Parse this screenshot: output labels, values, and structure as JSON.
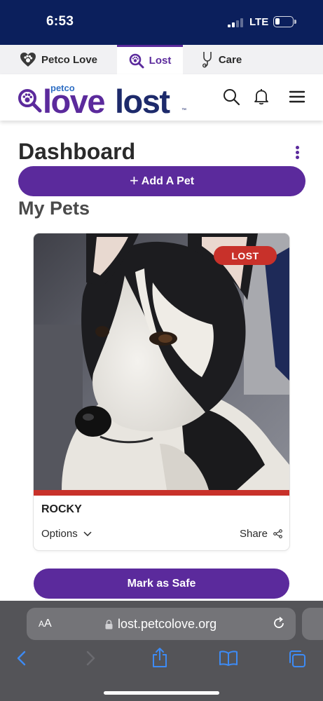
{
  "status_bar": {
    "time": "6:53",
    "carrier": "LTE",
    "battery_level": 0.28
  },
  "brand_tabs": [
    {
      "label": "Petco Love",
      "icon": "heart-paw-icon",
      "active": false
    },
    {
      "label": "Lost",
      "icon": "search-paw-icon",
      "active": true
    },
    {
      "label": "Care",
      "icon": "stethoscope-icon",
      "active": false
    }
  ],
  "header": {
    "logo_petco": "petco",
    "logo_love": "love",
    "logo_lost": "lost",
    "logo_tm": "™",
    "icons": [
      "search-icon",
      "bell-icon",
      "hamburger-menu-icon"
    ]
  },
  "dashboard": {
    "title": "Dashboard",
    "add_pet_plus": "+",
    "add_pet_label": "Add A Pet",
    "my_pets_heading": "My Pets"
  },
  "pet_card": {
    "status_badge": "LOST",
    "name": "ROCKY",
    "options_label": "Options",
    "share_label": "Share",
    "photo": "husky-dog-photo"
  },
  "mark_safe_label": "Mark as Safe",
  "browser": {
    "aa_small": "A",
    "aa_large": "A",
    "url": "lost.petcolove.org",
    "icons": [
      "back-arrow-icon",
      "forward-arrow-icon",
      "share-icon",
      "bookmarks-icon",
      "tabs-icon"
    ]
  },
  "colors": {
    "brand_purple": "#5b2a9c",
    "brand_navy": "#1d2a6b",
    "status_bar": "#0b1f5c",
    "lost_red": "#c8312a",
    "ios_blue": "#3d8bf5"
  }
}
